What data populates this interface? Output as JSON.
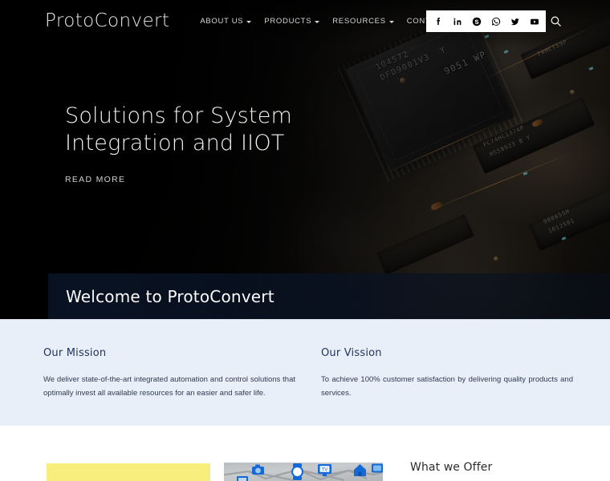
{
  "site": {
    "logo": "ProtoConvert"
  },
  "nav": {
    "items": [
      {
        "label": "ABOUT US",
        "has_dropdown": true
      },
      {
        "label": "PRODUCTS",
        "has_dropdown": true
      },
      {
        "label": "RESOURCES",
        "has_dropdown": true
      },
      {
        "label": "CONTACT US",
        "has_dropdown": false
      }
    ],
    "social": [
      {
        "name": "facebook-icon",
        "title": "Facebook"
      },
      {
        "name": "linkedin-icon",
        "title": "LinkedIn"
      },
      {
        "name": "skype-icon",
        "title": "Skype"
      },
      {
        "name": "whatsapp-icon",
        "title": "WhatsApp"
      },
      {
        "name": "twitter-icon",
        "title": "Twitter"
      },
      {
        "name": "youtube-icon",
        "title": "YouTube"
      }
    ],
    "search": {
      "name": "search-icon",
      "title": "Search"
    }
  },
  "hero": {
    "title_line1": "Solutions for System",
    "title_line2": "Integration and IIOT",
    "cta": "READ MORE",
    "chip_label": "104572\nDFD9001V3  Y",
    "chip_label2": "9051 WP",
    "board_text": [
      "PC74HC1374P",
      "HS58923  B  Y",
      "74HCT59P",
      "9006SSH",
      "1012501"
    ]
  },
  "welcome": {
    "heading": "Welcome to ProtoConvert"
  },
  "mission_vision": {
    "columns": [
      {
        "heading": "Our Mission",
        "body": "We deliver state-of-the-art integrated automation and control solutions that optimally invest all available resources for an easier and safer life."
      },
      {
        "heading": "Our Vission",
        "body": "To achieve 100% customer satisfaction by delivering quality products and services."
      }
    ]
  },
  "offer": {
    "heading": "What we Offer",
    "yellow_card_color": "#f8ee7e",
    "iot_icons": [
      "camera-icon",
      "smartwatch-icon",
      "tv-icon",
      "home-icon",
      "tablet-icon",
      "laptop-icon"
    ]
  },
  "colors": {
    "hero_bg": "#050505",
    "mission_bg": "#e9eff8",
    "heading_navy": "#22335c",
    "welcome_overlay": "#0a1426",
    "iot_blue": "#1569d6"
  }
}
